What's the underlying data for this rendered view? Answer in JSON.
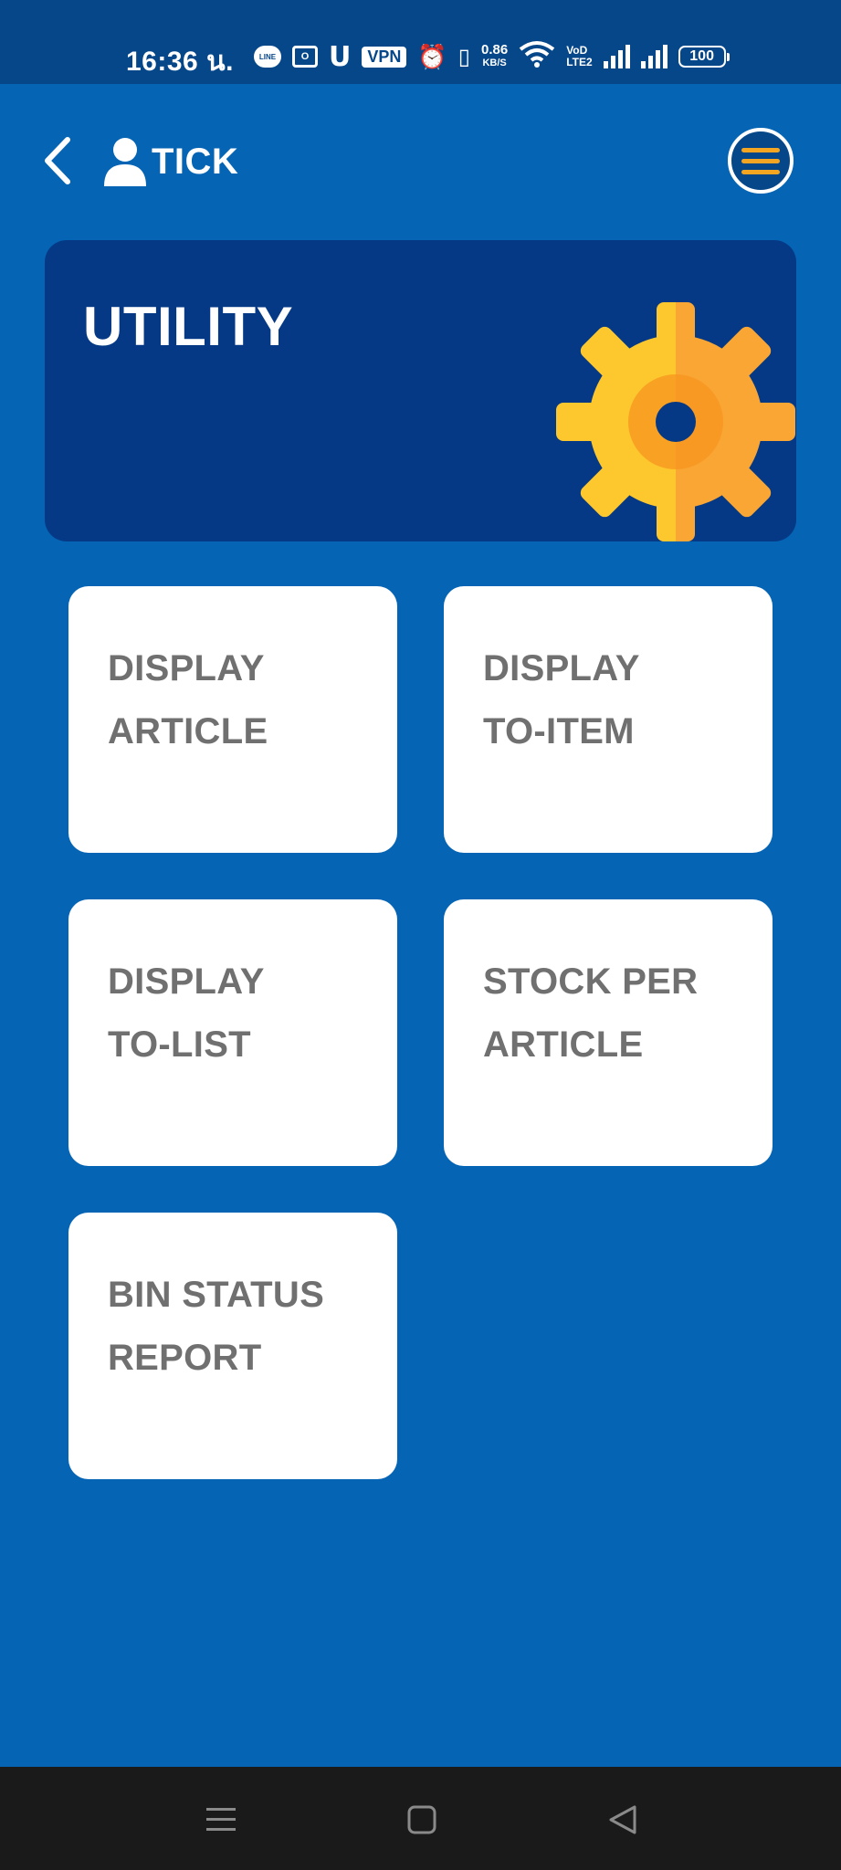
{
  "status_bar": {
    "time": "16:36 น.",
    "icons": [
      "line-icon",
      "outlook-icon",
      "ucloud-icon",
      "vpn-badge",
      "alarm-icon",
      "vibrate-icon",
      "data-rate",
      "wifi-icon",
      "volte-icon",
      "signal-icon",
      "signal-icon",
      "battery-icon"
    ],
    "line_label": "LINE",
    "vpn_label": "VPN",
    "rate_value": "0.86",
    "rate_unit": "KB/S",
    "volte_top": "VoD",
    "volte_bottom": "LTE2",
    "battery_level": "100"
  },
  "header": {
    "user_name": "TICK",
    "back_icon": "chevron-left-icon",
    "user_icon": "person-icon",
    "menu_icon": "hamburger-icon"
  },
  "banner": {
    "title": "UTILITY",
    "icon": "gear-icon",
    "colors": {
      "gear_light": "#fdc72e",
      "gear_dark": "#f9a634",
      "hub": "#f7941f"
    }
  },
  "menu_tiles": [
    {
      "line1": "DISPLAY",
      "line2": "ARTICLE"
    },
    {
      "line1": "DISPLAY",
      "line2": "TO-ITEM"
    },
    {
      "line1": "DISPLAY",
      "line2": "TO-LIST"
    },
    {
      "line1": "STOCK PER",
      "line2": "ARTICLE"
    },
    {
      "line1": "BIN STATUS",
      "line2": "REPORT"
    }
  ],
  "nav_bar": {
    "buttons": [
      "recents-icon",
      "home-icon",
      "back-triangle-icon"
    ]
  },
  "colors": {
    "background": "#0564b4",
    "status_bar": "#06478a",
    "banner": "#053985",
    "tile_text": "#707070",
    "menu_accent": "#f4a623",
    "nav_bar": "#1a1a1a"
  }
}
